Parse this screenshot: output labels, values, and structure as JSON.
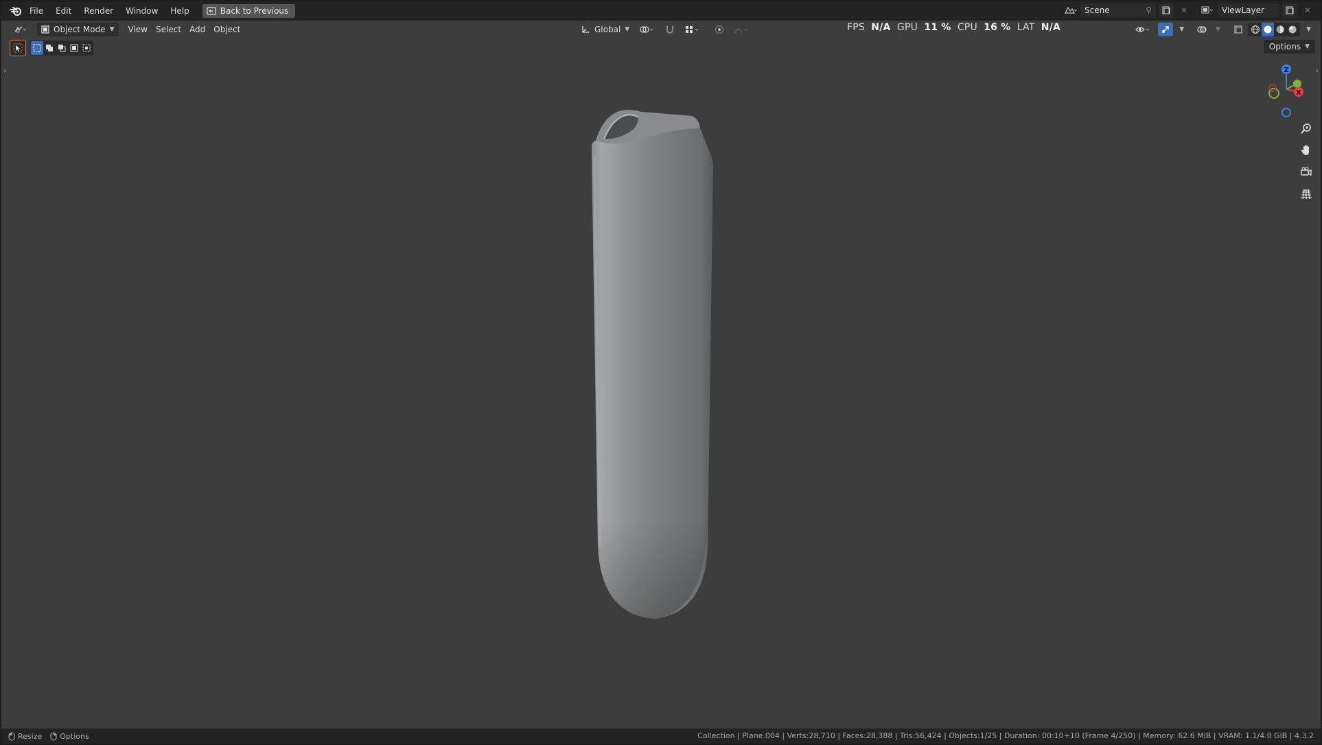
{
  "menubar": {
    "items": [
      "File",
      "Edit",
      "Render",
      "Window",
      "Help"
    ],
    "back_button": "Back to Previous",
    "scene_label": "Scene",
    "viewlayer_label": "ViewLayer"
  },
  "header": {
    "mode": "Object Mode",
    "menus": [
      "View",
      "Select",
      "Add",
      "Object"
    ],
    "transform_orientation": "Global",
    "perf": {
      "fps_label": "FPS",
      "fps_value": "N/A",
      "gpu_label": "GPU",
      "gpu_value": "11 %",
      "cpu_label": "CPU",
      "cpu_value": "16 %",
      "lat_label": "LAT",
      "lat_value": "N/A"
    },
    "options_label": "Options"
  },
  "gizmo": {
    "z_label": "Z",
    "x_label": "X",
    "colors": {
      "x": "#e8404a",
      "y": "#7fb03a",
      "z": "#3a82e0"
    }
  },
  "statusbar": {
    "left": [
      {
        "icon": "mouse-left-icon",
        "label": "Resize"
      },
      {
        "icon": "mouse-right-icon",
        "label": "Options"
      }
    ],
    "info": "Collection | Plane.004 | Verts:28,710 | Faces:28,388 | Tris:56,424 | Objects:1/25 | Duration: 00:10+10 (Frame 4/250) | Memory: 62.6 MiB | VRAM: 1.1/4.0 GiB | 4.3.2"
  },
  "colors": {
    "viewport_bg": "#3d3d3d",
    "bar_bg": "#232323",
    "accent_blue": "#3d6fb3"
  }
}
